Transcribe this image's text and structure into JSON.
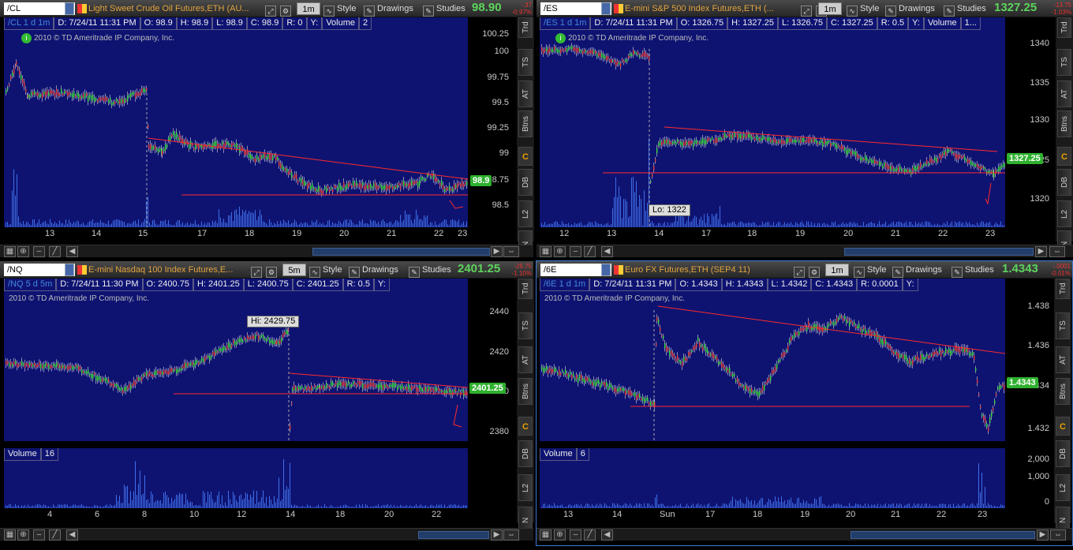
{
  "panels": [
    {
      "symbol": "/CL",
      "desc": "Light Sweet Crude Oil Futures,ETH (AU...",
      "tf": "1m",
      "style": "Style",
      "drawings": "Drawings",
      "studies": "Studies",
      "last": "98.90",
      "chg1": "-.37",
      "chg2": "-0.97%",
      "info": [
        "/CL 1 d 1m",
        "D: 7/24/11 11:31 PM",
        "O: 98.9",
        "H: 98.9",
        "L: 98.9",
        "C: 98.9",
        "R: 0",
        "Y:",
        "Volume",
        "2"
      ],
      "copy": "2010 © TD Ameritrade IP Company, Inc.",
      "yticks": [
        "100.25",
        "100",
        "99.75",
        "99.5",
        "99.25",
        "99",
        "98.75",
        "98.5"
      ],
      "xticks": [
        "13",
        "14",
        "15",
        "17",
        "18",
        "19",
        "20",
        "21",
        "22",
        "23"
      ],
      "pricebox": "98.9",
      "color_bg": "#0e1372"
    },
    {
      "symbol": "/ES",
      "desc": "E-mini S&P 500 Index Futures,ETH (...",
      "tf": "1m",
      "style": "Style",
      "drawings": "Drawings",
      "studies": "Studies",
      "last": "1327.25",
      "chg1": "-13.75",
      "chg2": "-1.03%",
      "info": [
        "/ES 1 d 1m",
        "D: 7/24/11 11:31 PM",
        "O: 1326.75",
        "H: 1327.25",
        "L: 1326.75",
        "C: 1327.25",
        "R: 0.5",
        "Y:",
        "Volume",
        "1..."
      ],
      "copy": "2010 © TD Ameritrade IP Company, Inc.",
      "yticks": [
        "1340",
        "1335",
        "1330",
        "1325",
        "1320"
      ],
      "xticks": [
        "12",
        "13",
        "14",
        "17",
        "18",
        "19",
        "20",
        "21",
        "22",
        "23"
      ],
      "pricebox": "1327.25",
      "lo": "Lo: 1322"
    },
    {
      "symbol": "/NQ",
      "desc": "E-mini Nasdaq 100 Index Futures,E...",
      "tf": "5m",
      "style": "Style",
      "drawings": "Drawings",
      "studies": "Studies",
      "last": "2401.25",
      "chg1": "-26.75",
      "chg2": "-1.10%",
      "info": [
        "/NQ 5 d 5m",
        "D: 7/24/11 11:30 PM",
        "O: 2400.75",
        "H: 2401.25",
        "L: 2400.75",
        "C: 2401.25",
        "R: 0.5",
        "Y:"
      ],
      "copy": "2010 © TD Ameritrade IP Company, Inc.",
      "yticks": [
        "2440",
        "2420",
        "2400",
        "2380"
      ],
      "xticks": [
        "4",
        "6",
        "8",
        "10",
        "12",
        "14",
        "18",
        "20",
        "22"
      ],
      "pricebox": "2401.25",
      "hi": "Hi: 2429.75",
      "vol_label": "Volume",
      "vol_val": "16"
    },
    {
      "symbol": "/6E",
      "desc": "Euro FX Futures,ETH (SEP4 11)",
      "tf": "1m",
      "style": "Style",
      "drawings": "Drawings",
      "studies": "Studies",
      "last": "1.4343",
      "chg1": "-.0001",
      "chg2": "-0.01%",
      "info": [
        "/6E 1 d 1m",
        "D: 7/24/11 11:31 PM",
        "O: 1.4343",
        "H: 1.4343",
        "L: 1.4342",
        "C: 1.4343",
        "R: 0.0001",
        "Y:"
      ],
      "copy": "2010 © TD Ameritrade IP Company, Inc.",
      "yticks": [
        "1.438",
        "1.436",
        "1.434",
        "1.432"
      ],
      "xticks": [
        "13",
        "14",
        "Sun",
        "17",
        "18",
        "19",
        "20",
        "21",
        "22",
        "23"
      ],
      "pricebox": "1.4343",
      "vol_label": "Volume",
      "vol_val": "6",
      "vticks": [
        "2,000",
        "1,000",
        "0"
      ]
    }
  ],
  "sidebar": [
    "Trd",
    "TS",
    "AT",
    "Btns",
    "C",
    "DB",
    "L2",
    "N"
  ],
  "colors": {
    "accent": "#5dd45d",
    "plot_bg": "#0e1372",
    "trend": "#ff2a2a",
    "bull": "#3ddc3d",
    "bear": "#e04040",
    "volume": "#3f6fe8"
  }
}
